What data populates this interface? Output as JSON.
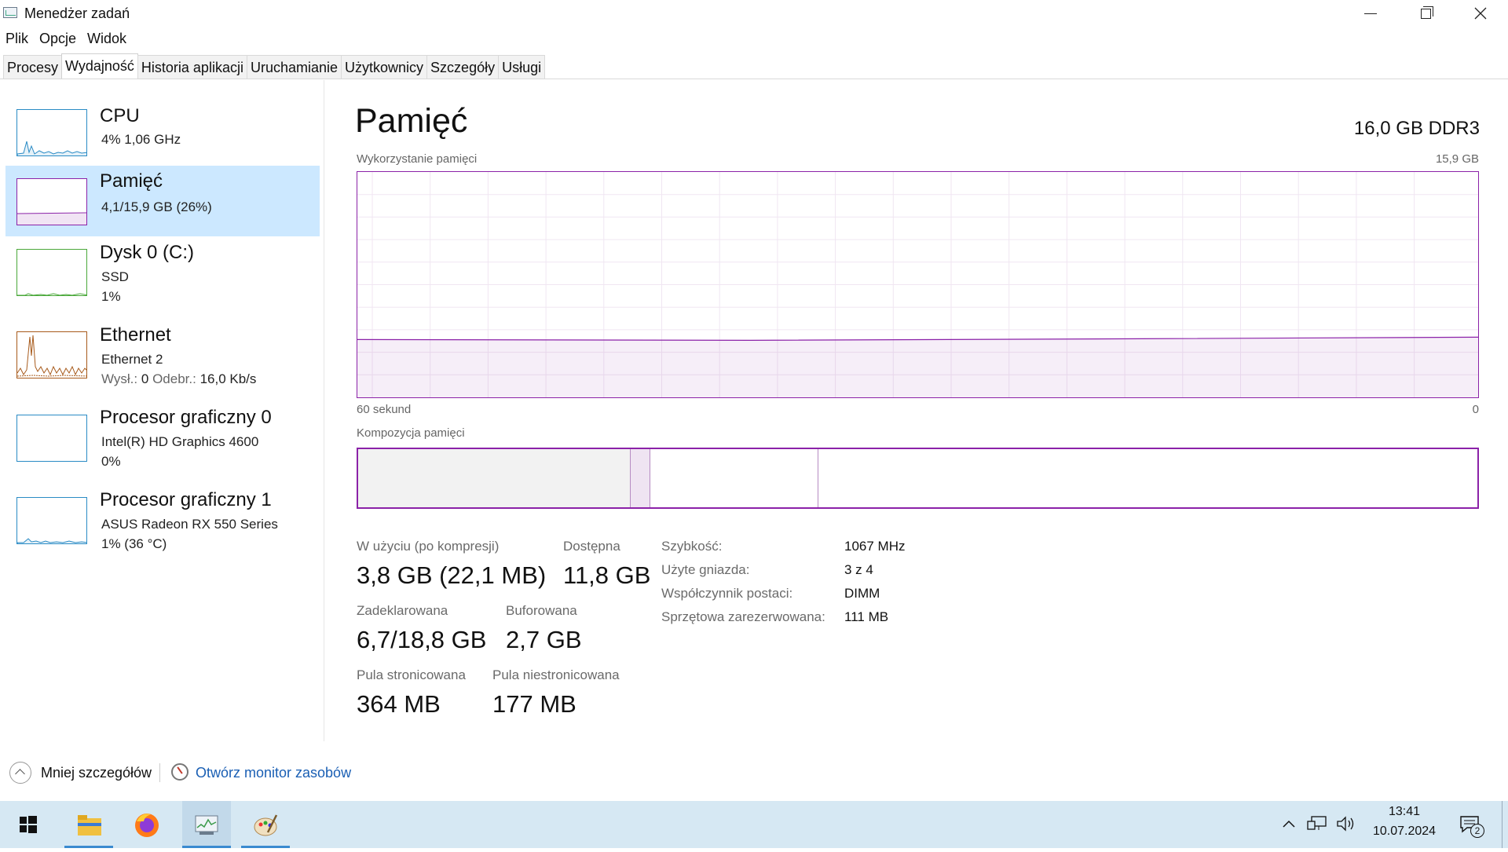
{
  "window": {
    "title": "Menedżer zadań"
  },
  "menu": [
    "Plik",
    "Opcje",
    "Widok"
  ],
  "tabs": [
    {
      "label": "Procesy",
      "active": false
    },
    {
      "label": "Wydajność",
      "active": true
    },
    {
      "label": "Historia aplikacji",
      "active": false
    },
    {
      "label": "Uruchamianie",
      "active": false
    },
    {
      "label": "Użytkownicy",
      "active": false
    },
    {
      "label": "Szczegóły",
      "active": false
    },
    {
      "label": "Usługi",
      "active": false
    }
  ],
  "sidebar": {
    "items": [
      {
        "title": "CPU",
        "line1": "4%  1,06 GHz",
        "line2": "",
        "color": "#2a8bc5"
      },
      {
        "title": "Pamięć",
        "line1": "4,1/15,9 GB (26%)",
        "line2": "",
        "color": "#8b22a8",
        "selected": true
      },
      {
        "title": "Dysk 0 (C:)",
        "line1": "SSD",
        "line2": "1%",
        "color": "#4aa83a"
      },
      {
        "title": "Ethernet",
        "line1": "Ethernet 2",
        "line2_label_a": "Wysł.:",
        "line2_val_a": "0",
        "line2_label_b": "Odebr.:",
        "line2_val_b": "16,0 Kb/s",
        "color": "#a75a1b"
      },
      {
        "title": "Procesor graficzny 0",
        "line1": "Intel(R) HD Graphics 4600",
        "line2": "0%",
        "color": "#2a8bc5"
      },
      {
        "title": "Procesor graficzny 1",
        "line1": "ASUS Radeon RX 550 Series",
        "line2": "1% (36 °C)",
        "color": "#2a8bc5"
      }
    ]
  },
  "main": {
    "title": "Pamięć",
    "type": "16,0 GB DDR3",
    "usage_label": "Wykorzystanie pamięci",
    "usage_max": "15,9 GB",
    "time_left": "60 sekund",
    "time_right": "0",
    "composition_label": "Kompozycja pamięci",
    "usage_fraction": 0.26,
    "composition": {
      "in_use_fraction": 0.243,
      "modified_fraction": 0.018,
      "standby_fraction": 0.15
    },
    "stats": {
      "in_use_label": "W użyciu (po kompresji)",
      "in_use_value": "3,8 GB (22,1 MB)",
      "available_label": "Dostępna",
      "available_value": "11,8 GB",
      "committed_label": "Zadeklarowana",
      "committed_value": "6,7/18,8 GB",
      "cached_label": "Buforowana",
      "cached_value": "2,7 GB",
      "paged_label": "Pula stronicowana",
      "paged_value": "364 MB",
      "nonpaged_label": "Pula niestronicowana",
      "nonpaged_value": "177 MB"
    },
    "props": [
      {
        "label": "Szybkość:",
        "value": "1067 MHz"
      },
      {
        "label": "Użyte gniazda:",
        "value": "3 z 4"
      },
      {
        "label": "Współczynnik postaci:",
        "value": "DIMM"
      },
      {
        "label": "Sprzętowa zarezerwowana:",
        "value": "111 MB"
      }
    ]
  },
  "footer": {
    "less_details": "Mniej szczegółów",
    "open_monitor": "Otwórz monitor zasobów"
  },
  "taskbar": {
    "time": "13:41",
    "date": "10.07.2024",
    "notifications": "2"
  }
}
